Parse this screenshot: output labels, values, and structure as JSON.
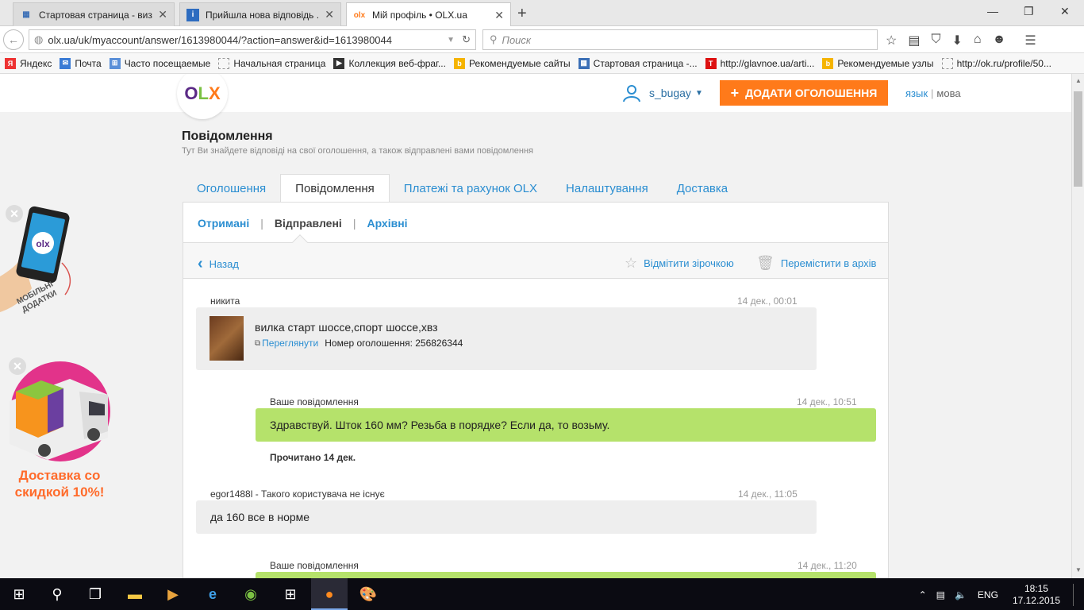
{
  "browser": {
    "tabs": [
      {
        "title": "Стартовая страница - виз...",
        "active": false
      },
      {
        "title": "Прийшла нова відповідь ...",
        "active": false
      },
      {
        "title": "Мій профіль • OLX.ua",
        "active": true
      }
    ],
    "url": "olx.ua/uk/myaccount/answer/1613980044/?action=answer&id=1613980044",
    "search_placeholder": "Поиск",
    "bookmarks": [
      "Яндекс",
      "Почта",
      "Часто посещаемые",
      "Начальная страница",
      "Коллекция веб-фраг...",
      "Рекомендуемые сайты",
      "Стартовая страница -...",
      "http://glavnoe.ua/arti...",
      "Рекомендуемые узлы",
      "http://ok.ru/profile/50..."
    ]
  },
  "header": {
    "logo": "OLX",
    "username": "s_bugay",
    "add_button": "ДОДАТИ ОГОЛОШЕННЯ",
    "lang_a": "язык",
    "lang_b": "мова"
  },
  "page": {
    "title": "Повідомлення",
    "subtitle": "Тут Ви знайдете відповіді на свої оголошення, а також відправлені вами повідомлення"
  },
  "tabs": [
    "Оголошення",
    "Повідомлення",
    "Платежі та рахунок OLX",
    "Налаштування",
    "Доставка"
  ],
  "subtabs": [
    "Отримані",
    "Відправлені",
    "Архівні"
  ],
  "toolbar": {
    "back": "Назад",
    "star": "Відмітити зірочкою",
    "archive": "Перемістити в архів"
  },
  "messages": {
    "m1_author": "никита",
    "m1_time": "14 дек., 00:01",
    "ad_title": "вилка старт шоссе,спорт шоссе,хвз",
    "ad_view": "Переглянути",
    "ad_number": "Номер оголошення: 256826344",
    "m2_author": "Ваше повідомлення",
    "m2_time": "14 дек., 10:51",
    "m2_text": "Здравствуй. Шток 160 мм? Резьба в порядке? Если да, то возьму.",
    "m2_read": "Прочитано 14 дек.",
    "m3_author": "egor1488l - Такого користувача не існує",
    "m3_time": "14 дек., 11:05",
    "m3_text": "да 160 все в норме",
    "m4_author": "Ваше повідомлення",
    "m4_time": "14 дек., 11:20"
  },
  "promos": {
    "app_text_1": "МОБІЛЬНІ",
    "app_text_2": "ДОДАТКИ",
    "delivery_1": "Доставка со",
    "delivery_2": "скидкой 10%!"
  },
  "taskbar": {
    "lang": "ENG",
    "time": "18:15",
    "date": "17.12.2015"
  },
  "colors": {
    "accent_blue": "#2b8ed1",
    "orange": "#ff7a1a",
    "green_bubble": "#b5e26b"
  }
}
